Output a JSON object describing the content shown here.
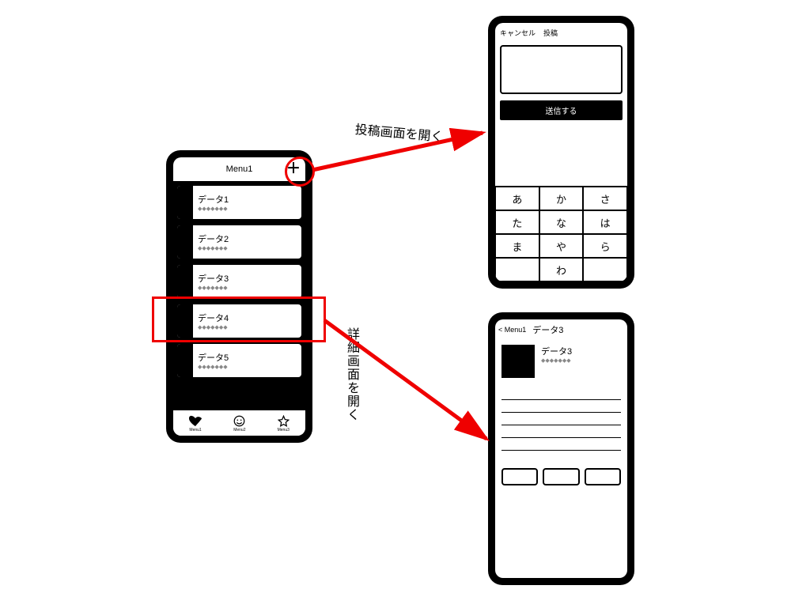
{
  "main": {
    "header_title": "Menu1",
    "plus": "＋",
    "items": [
      {
        "title": "データ1",
        "sub": "◆◆◆◆◆◆◆"
      },
      {
        "title": "データ2",
        "sub": "◆◆◆◆◆◆◆"
      },
      {
        "title": "データ3",
        "sub": "◆◆◆◆◆◆◆"
      },
      {
        "title": "データ4",
        "sub": "◆◆◆◆◆◆◆"
      },
      {
        "title": "データ5",
        "sub": "◆◆◆◆◆◆◆"
      }
    ],
    "tabs": [
      {
        "label": "Menu1",
        "icon": "heart"
      },
      {
        "label": "Menu2",
        "icon": "smile"
      },
      {
        "label": "Menu3",
        "icon": "star"
      }
    ]
  },
  "post": {
    "cancel": "キャンセル",
    "title": "投稿",
    "submit": "送信する",
    "keys": [
      "あ",
      "か",
      "さ",
      "た",
      "な",
      "は",
      "ま",
      "や",
      "ら",
      "",
      "わ",
      ""
    ]
  },
  "detail": {
    "back": "< Menu1",
    "header_title": "データ3",
    "item_title": "データ3",
    "item_sub": "◆◆◆◆◆◆◆"
  },
  "annotations": {
    "open_post": "投稿画面を開く",
    "open_detail": "詳細画面を開く"
  }
}
